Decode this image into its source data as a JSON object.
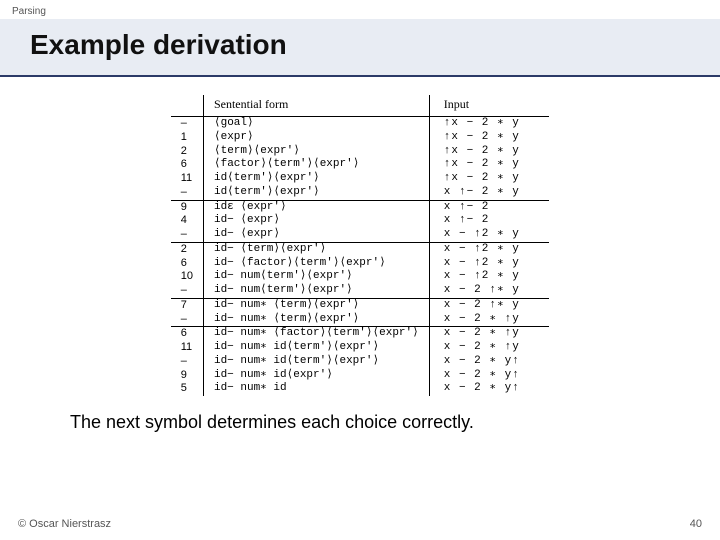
{
  "topic": "Parsing",
  "title": "Example derivation",
  "headers": {
    "rule": "",
    "sentential": "Sentential form",
    "input": "Input"
  },
  "rows": [
    {
      "r": "–",
      "s": "⟨goal⟩",
      "i": "↑x − 2 ∗ y",
      "sep": false
    },
    {
      "r": "1",
      "s": "⟨expr⟩",
      "i": "↑x − 2 ∗ y",
      "sep": false
    },
    {
      "r": "2",
      "s": "⟨term⟩⟨expr′⟩",
      "i": "↑x − 2 ∗ y",
      "sep": false
    },
    {
      "r": "6",
      "s": "⟨factor⟩⟨term′⟩⟨expr′⟩",
      "i": "↑x − 2 ∗ y",
      "sep": false
    },
    {
      "r": "11",
      "s": "id⟨term′⟩⟨expr′⟩",
      "i": "↑x − 2 ∗ y",
      "sep": false
    },
    {
      "r": "–",
      "s": "id⟨term′⟩⟨expr′⟩",
      "i": "x ↑− 2 ∗ y",
      "sep": false
    },
    {
      "r": "9",
      "s": "idε ⟨expr′⟩",
      "i": "x ↑− 2",
      "sep": true
    },
    {
      "r": "4",
      "s": "id− ⟨expr⟩",
      "i": "x ↑− 2",
      "sep": false
    },
    {
      "r": "–",
      "s": "id− ⟨expr⟩",
      "i": "x − ↑2 ∗ y",
      "sep": false
    },
    {
      "r": "2",
      "s": "id− ⟨term⟩⟨expr′⟩",
      "i": "x − ↑2 ∗ y",
      "sep": true
    },
    {
      "r": "6",
      "s": "id− ⟨factor⟩⟨term′⟩⟨expr′⟩",
      "i": "x − ↑2 ∗ y",
      "sep": false
    },
    {
      "r": "10",
      "s": "id− num⟨term′⟩⟨expr′⟩",
      "i": "x − ↑2 ∗ y",
      "sep": false
    },
    {
      "r": "–",
      "s": "id− num⟨term′⟩⟨expr′⟩",
      "i": "x − 2 ↑∗ y",
      "sep": false
    },
    {
      "r": "7",
      "s": "id− num∗ ⟨term⟩⟨expr′⟩",
      "i": "x − 2 ↑∗ y",
      "sep": true
    },
    {
      "r": "–",
      "s": "id− num∗ ⟨term⟩⟨expr′⟩",
      "i": "x − 2 ∗ ↑y",
      "sep": false
    },
    {
      "r": "6",
      "s": "id− num∗ ⟨factor⟩⟨term′⟩⟨expr′⟩",
      "i": "x − 2 ∗ ↑y",
      "sep": true
    },
    {
      "r": "11",
      "s": "id− num∗ id⟨term′⟩⟨expr′⟩",
      "i": "x − 2 ∗ ↑y",
      "sep": false
    },
    {
      "r": "–",
      "s": "id− num∗ id⟨term′⟩⟨expr′⟩",
      "i": "x − 2 ∗ y↑",
      "sep": false
    },
    {
      "r": "9",
      "s": "id− num∗ id⟨expr′⟩",
      "i": "x − 2 ∗ y↑",
      "sep": false
    },
    {
      "r": "5",
      "s": "id− num∗ id",
      "i": "x − 2 ∗ y↑",
      "sep": false
    }
  ],
  "caption": "The next symbol determines each choice correctly.",
  "footer": {
    "copyright": "© Oscar Nierstrasz",
    "page": "40"
  }
}
